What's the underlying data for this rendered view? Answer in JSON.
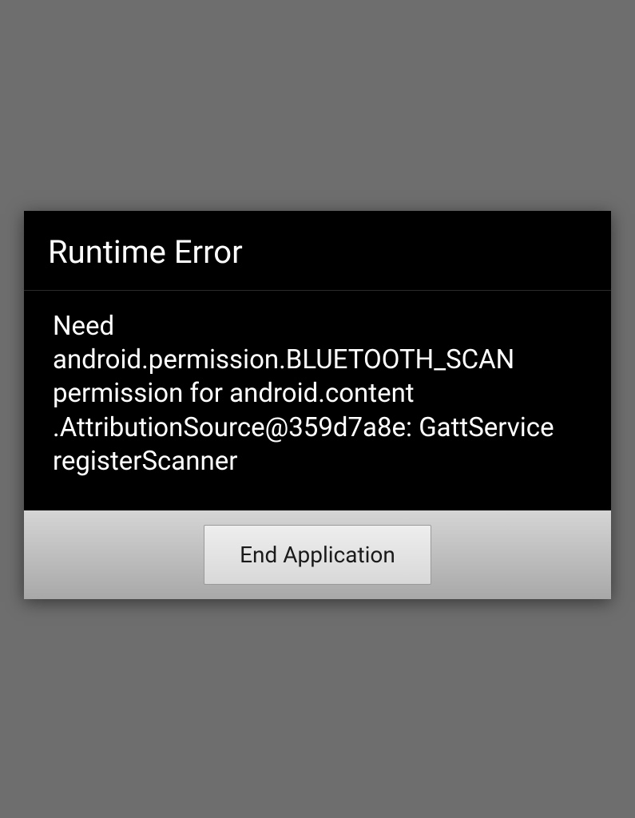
{
  "dialog": {
    "title": "Runtime Error",
    "message": "Need android.permission.BLUETOOTH_SCAN permission for android.content\n.AttributionSource@359d7a8e: GattService registerScanner",
    "button_label": "End Application"
  }
}
